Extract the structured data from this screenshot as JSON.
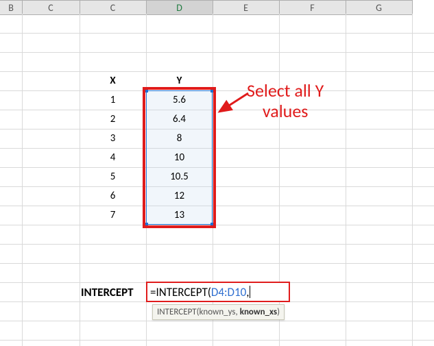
{
  "columns": {
    "B": "B",
    "C": "C",
    "D": "D",
    "E": "E",
    "F": "F",
    "G": "G"
  },
  "active_column": "D",
  "headers": {
    "x": "X",
    "y": "Y"
  },
  "rows": [
    {
      "x": "1",
      "y": "5.6"
    },
    {
      "x": "2",
      "y": "6.4"
    },
    {
      "x": "3",
      "y": "8"
    },
    {
      "x": "4",
      "y": "10"
    },
    {
      "x": "5",
      "y": "10.5"
    },
    {
      "x": "6",
      "y": "12"
    },
    {
      "x": "7",
      "y": "13"
    }
  ],
  "selection": {
    "range": "D4:D10"
  },
  "annotation": {
    "line1": "Select all Y",
    "line2": "values"
  },
  "formula": {
    "label_left": "INTERCEPT",
    "prefix": "=INTERCEPT(",
    "ref": "D4:D10",
    "suffix": ","
  },
  "tooltip": {
    "fn": "INTERCEPT(",
    "arg1": "known_ys",
    "sep": ", ",
    "arg2": "known_xs",
    "close": ")"
  },
  "colors": {
    "red": "#e01b1b",
    "blue": "#2f6fd0"
  }
}
